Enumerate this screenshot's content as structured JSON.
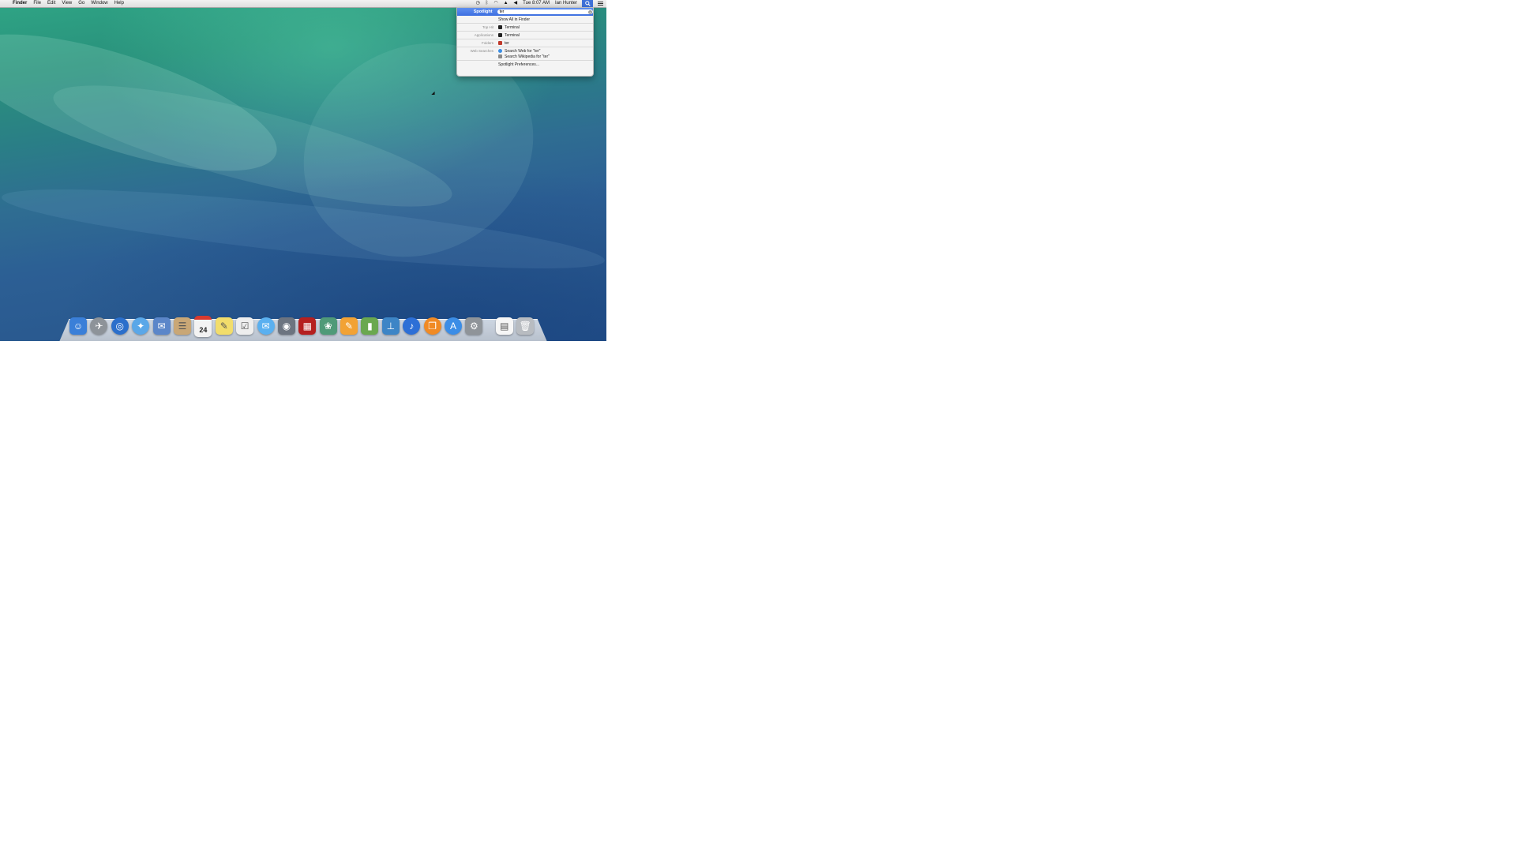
{
  "menubar": {
    "apple_glyph": "",
    "items": [
      "Finder",
      "File",
      "Edit",
      "View",
      "Go",
      "Window",
      "Help"
    ],
    "status": {
      "wifi": "wifi-icon",
      "volume": "volume-icon",
      "time": "Tue 8:07 AM",
      "user": "Ian Hunter"
    }
  },
  "spotlight": {
    "label": "Spotlight",
    "query": "ter",
    "rows": [
      {
        "category": "",
        "text": "Show All in Finder",
        "icon_color": ""
      },
      {
        "category": "Top Hit",
        "text": "Terminal",
        "icon_color": "#222222"
      },
      {
        "category": "Applications",
        "text": "Terminal",
        "icon_color": "#222222"
      },
      {
        "category": "Folders",
        "text": "ter",
        "icon_color": "#c0392b"
      },
      {
        "category": "Web Searches",
        "text": "Search Web for \"ter\"",
        "icon_color": "#3a8ee6"
      },
      {
        "category": "",
        "text": "Search Wikipedia for \"ter\"",
        "icon_color": "#8a8a8a"
      },
      {
        "category": "",
        "text": "Spotlight Preferences...",
        "icon_color": ""
      }
    ]
  },
  "dock": {
    "items": [
      {
        "name": "finder-icon",
        "color": "#3a7fd8",
        "glyph": "☺"
      },
      {
        "name": "launchpad-icon",
        "color": "#8d9399",
        "glyph": "✈"
      },
      {
        "name": "mission-control-icon",
        "color": "#2b6fcb",
        "glyph": "◎"
      },
      {
        "name": "safari-icon",
        "color": "#5aa7e8",
        "glyph": "✦"
      },
      {
        "name": "mail-icon",
        "color": "#5b86c9",
        "glyph": "✉"
      },
      {
        "name": "contacts-icon",
        "color": "#c9a776",
        "glyph": "☰"
      },
      {
        "name": "calendar-icon",
        "color": "#f3f3f3",
        "glyph": "24"
      },
      {
        "name": "notes-icon",
        "color": "#f2dd6b",
        "glyph": "✎"
      },
      {
        "name": "reminders-icon",
        "color": "#eeeeee",
        "glyph": "☑"
      },
      {
        "name": "messages-icon",
        "color": "#5ab0f0",
        "glyph": "✉"
      },
      {
        "name": "facetime-icon",
        "color": "#6c7480",
        "glyph": "◉"
      },
      {
        "name": "photo-booth-icon",
        "color": "#b52020",
        "glyph": "▦"
      },
      {
        "name": "iphoto-icon",
        "color": "#4f9a78",
        "glyph": "❀"
      },
      {
        "name": "pages-icon",
        "color": "#f2a234",
        "glyph": "✎"
      },
      {
        "name": "numbers-icon",
        "color": "#6aa84f",
        "glyph": "▮"
      },
      {
        "name": "keynote-icon",
        "color": "#3d85c6",
        "glyph": "⊥"
      },
      {
        "name": "itunes-icon",
        "color": "#2d6fd6",
        "glyph": "♪"
      },
      {
        "name": "ibooks-icon",
        "color": "#f08a24",
        "glyph": "❐"
      },
      {
        "name": "app-store-icon",
        "color": "#3b8de6",
        "glyph": "A"
      },
      {
        "name": "system-preferences-icon",
        "color": "#8f9499",
        "glyph": "⚙"
      }
    ],
    "trailing": [
      {
        "name": "documents-stack-icon",
        "color": "#f6f6f6",
        "glyph": "▤"
      },
      {
        "name": "trash-icon",
        "color": "#b8bcc1",
        "glyph": "🗑"
      }
    ]
  }
}
